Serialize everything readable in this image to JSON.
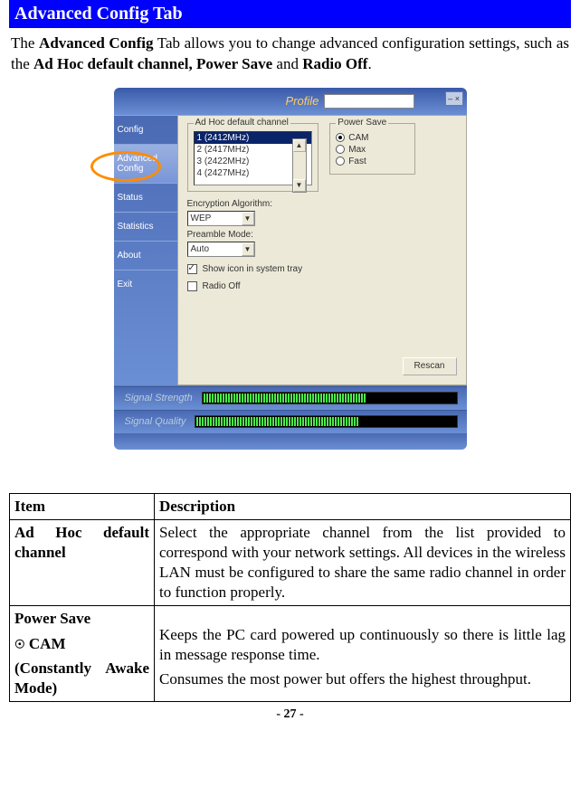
{
  "title": "Advanced Config Tab",
  "intro_parts": {
    "p1": "The ",
    "b1": "Advanced Config",
    "p2": " Tab allows you to change advanced configuration settings, such as the ",
    "b2": "Ad Hoc default channel, Power Save",
    "p3": " and ",
    "b3": "Radio Off",
    "p4": "."
  },
  "screenshot": {
    "profile_label": "Profile",
    "close": "–  ×",
    "sidebar": [
      "Config",
      "Advanced Config",
      "Status",
      "Statistics",
      "About",
      "Exit"
    ],
    "adhoc_label": "Ad Hoc default channel",
    "channels": [
      "1 (2412MHz)",
      "2 (2417MHz)",
      "3 (2422MHz)",
      "4 (2427MHz)"
    ],
    "selected_channel_index": 0,
    "power_label": "Power Save",
    "power_options": [
      "CAM",
      "Max",
      "Fast"
    ],
    "power_selected_index": 0,
    "encryption_label": "Encryption Algorithm:",
    "encryption_value": "WEP",
    "preamble_label": "Preamble Mode:",
    "preamble_value": "Auto",
    "show_tray": "Show icon in system tray",
    "radio_off": "Radio Off",
    "rescan": "Rescan",
    "signal_strength": "Signal Strength",
    "signal_quality": "Signal Quality"
  },
  "table": {
    "h1": "Item",
    "h2": "Description",
    "r1_item": "Ad Hoc default channel",
    "r1_desc": "Select the appropriate channel from the list provided to correspond with your network settings.  All devices in the wireless LAN must be configured to share the same radio channel in order to function properly.",
    "r2_item_line1": "Power Save",
    "r2_item_cam": " CAM",
    "r2_item_line3": "(Constantly Awake Mode)",
    "r2_desc_p1": "Keeps the PC card powered up continuously so there is little lag in message response time.",
    "r2_desc_p2": "Consumes the most power but offers the highest throughput."
  },
  "page": "- 27 -"
}
